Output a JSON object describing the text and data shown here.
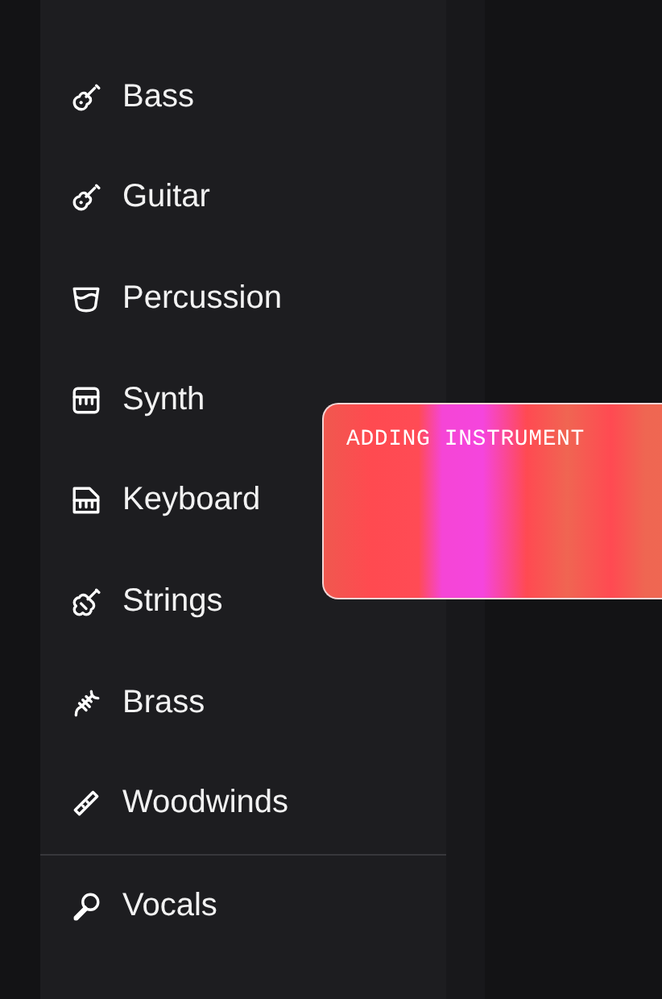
{
  "instrument_menu": {
    "sections": [
      {
        "items": [
          {
            "label": "Bass"
          },
          {
            "label": "Guitar"
          },
          {
            "label": "Percussion"
          },
          {
            "label": "Synth"
          },
          {
            "label": "Keyboard"
          },
          {
            "label": "Strings"
          },
          {
            "label": "Brass"
          },
          {
            "label": "Woodwinds"
          }
        ]
      },
      {
        "items": [
          {
            "label": "Vocals"
          }
        ]
      }
    ]
  },
  "toast": {
    "text": "ADDING INSTRUMENT"
  }
}
